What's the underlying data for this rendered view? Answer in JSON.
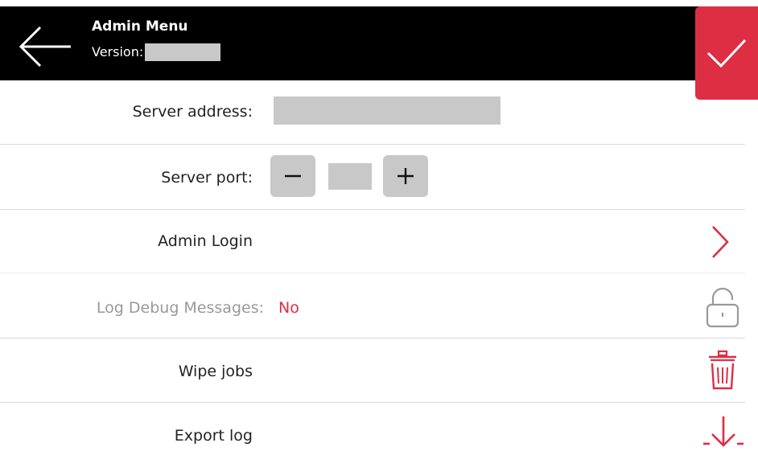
{
  "header": {
    "title": "Admin Menu",
    "version_label": "Version:",
    "version_value": ""
  },
  "server": {
    "address_label": "Server address:",
    "address_value": "",
    "port_label": "Server port:",
    "port_value": ""
  },
  "menu": {
    "admin_login_label": "Admin Login",
    "log_debug_label": "Log Debug Messages:",
    "log_debug_value": "No",
    "wipe_jobs_label": "Wipe jobs",
    "export_log_label": "Export log"
  },
  "icons": {
    "back": "arrow-left-icon",
    "confirm": "check-icon",
    "stepper_minus": "minus-icon",
    "stepper_plus": "plus-icon",
    "admin_login": "chevron-right-icon",
    "log_debug": "lock-icon",
    "wipe_jobs": "trash-icon",
    "export_log": "download-icon"
  },
  "colors": {
    "accent": "#dd2e44",
    "header_bg": "#000000",
    "placeholder_gray": "#c8c8c8",
    "disabled_text": "#999999"
  }
}
